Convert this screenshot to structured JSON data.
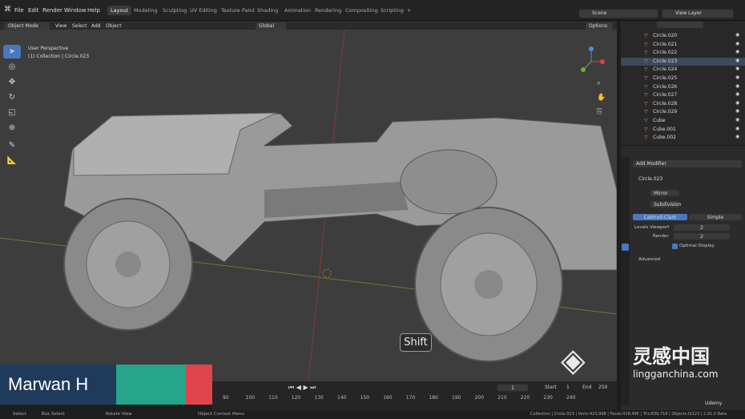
{
  "menu": [
    "File",
    "Edit",
    "Render",
    "Window",
    "Help"
  ],
  "workspaces": [
    {
      "label": "Layout",
      "active": true
    },
    {
      "label": "Modeling"
    },
    {
      "label": "Sculpting"
    },
    {
      "label": "UV Editing"
    },
    {
      "label": "Texture Paint"
    },
    {
      "label": "Shading"
    },
    {
      "label": "Animation"
    },
    {
      "label": "Rendering"
    },
    {
      "label": "Compositing"
    },
    {
      "label": "Scripting"
    }
  ],
  "scene": "Scene",
  "view_layer": "View Layer",
  "vheader": {
    "mode": "Object Mode",
    "menus": [
      "View",
      "Select",
      "Add",
      "Object"
    ],
    "orientation": "Global",
    "options": "Options"
  },
  "viewport": {
    "perspective": "User Perspective",
    "collection": "(1) Collection | Circle.023",
    "key_overlay": "Shift"
  },
  "outliner": [
    "Circle.020",
    "Circle.021",
    "Circle.022",
    "Circle.023",
    "Circle.024",
    "Circle.025",
    "Circle.026",
    "Circle.027",
    "Circle.028",
    "Circle.029",
    "Cube",
    "Cube.001",
    "Cube.002"
  ],
  "properties": {
    "add_modifier": "Add Modifier",
    "object": "Circle.023",
    "mod1": "Mirror",
    "mod2": "Subdivision",
    "catmull": "Catmull-Clark",
    "simple": "Simple",
    "levels_viewport_label": "Levels Viewport",
    "levels_viewport": "2",
    "render_label": "Render",
    "render": "2",
    "optimal": "Optimal Display",
    "advanced": "Advanced"
  },
  "timeline": {
    "frame": "1",
    "start_label": "Start",
    "start": "1",
    "end_label": "End",
    "end": "250",
    "ticks": [
      "90",
      "100",
      "110",
      "120",
      "130",
      "140",
      "150",
      "160",
      "170",
      "180",
      "190",
      "200",
      "210",
      "220",
      "230",
      "240"
    ]
  },
  "status": {
    "select": "Select",
    "box": "Box Select",
    "rotate": "Rotate View",
    "ctx": "Object Context Menu",
    "stats": "Collection | Circle.023 | Verts:423,998 | Faces:418,495 | Tris:839,718 | Objects:0/123 | 2.91.0 Beta"
  },
  "lower_third": {
    "name": "Marwan H",
    "colors": [
      "#1e3b5c",
      "#26a58a",
      "#e0454b"
    ]
  },
  "watermark": {
    "title": "灵感中国",
    "url": "lingganchina.com",
    "udemy": "Udemy"
  }
}
